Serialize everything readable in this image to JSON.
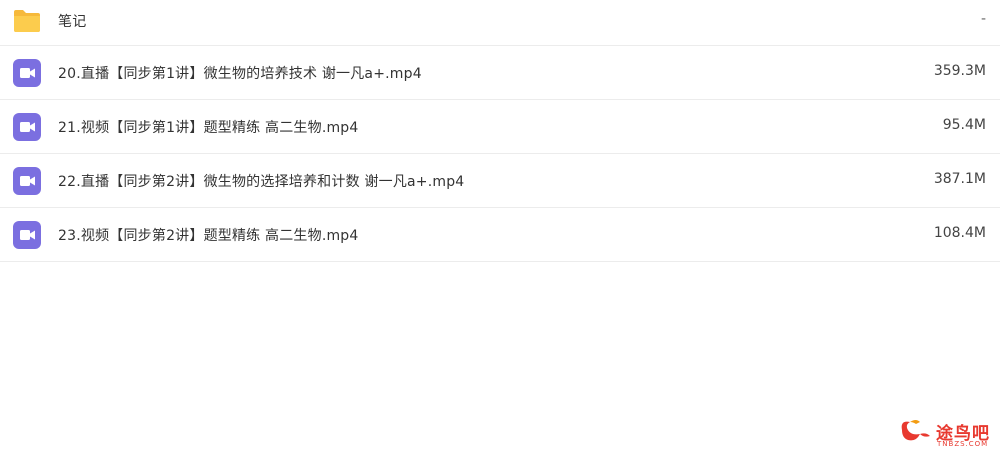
{
  "files": [
    {
      "name": "笔记",
      "size": "-",
      "type": "folder"
    },
    {
      "name": "20.直播【同步第1讲】微生物的培养技术 谢一凡a+.mp4",
      "size": "359.3M",
      "type": "video"
    },
    {
      "name": "21.视频【同步第1讲】题型精练 高二生物.mp4",
      "size": "95.4M",
      "type": "video"
    },
    {
      "name": "22.直播【同步第2讲】微生物的选择培养和计数 谢一凡a+.mp4",
      "size": "387.1M",
      "type": "video"
    },
    {
      "name": "23.视频【同步第2讲】题型精练 高二生物.mp4",
      "size": "108.4M",
      "type": "video"
    }
  ],
  "watermark": {
    "text": "途鸟吧",
    "sub": "TNBZS.COM"
  },
  "colors": {
    "folder": "#fccc4d",
    "video": "#7b6fe0",
    "watermark": "#e8392f"
  }
}
